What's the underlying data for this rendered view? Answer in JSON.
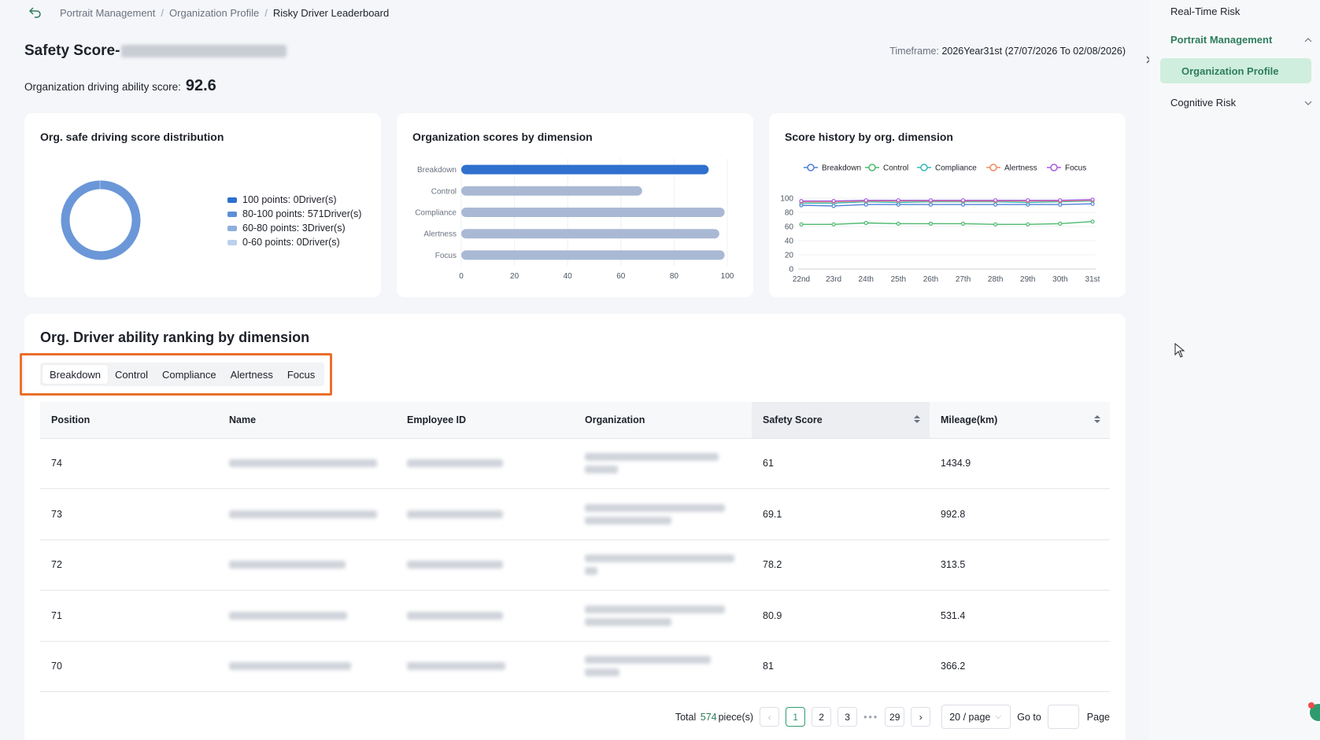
{
  "breadcrumb": {
    "items": [
      "Portrait Management",
      "Organization Profile",
      "Risky Driver Leaderboard"
    ]
  },
  "header": {
    "title_prefix": "Safety Score-",
    "timeframe_label": "Timeframe:",
    "timeframe_value": "2026Year31st (27/07/2026 To 02/08/2026)",
    "org_score_label": "Organization driving ability score:",
    "org_score_value": "92.6"
  },
  "cards": {
    "distribution": {
      "title": "Org. safe driving score distribution",
      "legend": [
        {
          "label": "100 points: 0Driver(s)",
          "color": "#2f6fce"
        },
        {
          "label": "80-100 points: 571Driver(s)",
          "color": "#5b8fd6"
        },
        {
          "label": "60-80 points: 3Driver(s)",
          "color": "#8faedd"
        },
        {
          "label": "0-60 points: 0Driver(s)",
          "color": "#bcd0ee"
        }
      ]
    },
    "dimension": {
      "title": "Organization scores by dimension"
    },
    "history": {
      "title": "Score history by org. dimension"
    }
  },
  "chart_data": [
    {
      "type": "pie",
      "title": "Org. safe driving score distribution",
      "categories": [
        "100 points",
        "80-100 points",
        "60-80 points",
        "0-60 points"
      ],
      "values": [
        0,
        571,
        3,
        0
      ],
      "colors": [
        "#2f6fce",
        "#6b97d8",
        "#8faedd",
        "#bcd0ee"
      ]
    },
    {
      "type": "bar",
      "title": "Organization scores by dimension",
      "orientation": "horizontal",
      "categories": [
        "Breakdown",
        "Control",
        "Compliance",
        "Alertness",
        "Focus"
      ],
      "values": [
        93,
        68,
        99,
        97,
        99
      ],
      "xlim": [
        0,
        100
      ],
      "ticks": [
        0,
        20,
        40,
        60,
        80,
        100
      ],
      "highlight_color": "#2f6fce",
      "color": "#a9b9d4"
    },
    {
      "type": "line",
      "title": "Score history by org. dimension",
      "x": [
        "22nd",
        "23rd",
        "24th",
        "25th",
        "26th",
        "27th",
        "28th",
        "29th",
        "30th",
        "31st"
      ],
      "ylim": [
        0,
        100
      ],
      "yticks": [
        0,
        20,
        40,
        60,
        80,
        100
      ],
      "legend_position": "top",
      "series": [
        {
          "name": "Breakdown",
          "color": "#4f7fd9",
          "values": [
            90,
            89,
            91,
            91,
            91,
            91,
            91,
            91,
            91,
            92
          ]
        },
        {
          "name": "Control",
          "color": "#4cba6c",
          "values": [
            63,
            63,
            65,
            64,
            64,
            64,
            63,
            63,
            64,
            67
          ]
        },
        {
          "name": "Compliance",
          "color": "#36b8b8",
          "values": [
            93,
            93,
            95,
            94,
            95,
            95,
            95,
            94,
            95,
            96
          ]
        },
        {
          "name": "Alertness",
          "color": "#f08a5d",
          "values": [
            95,
            95,
            96,
            96,
            96,
            96,
            96,
            96,
            96,
            97
          ]
        },
        {
          "name": "Focus",
          "color": "#a85ce0",
          "values": [
            96,
            96,
            97,
            97,
            97,
            97,
            97,
            97,
            97,
            98
          ]
        }
      ]
    }
  ],
  "ranking": {
    "title": "Org. Driver ability ranking by dimension",
    "tabs": [
      "Breakdown",
      "Control",
      "Compliance",
      "Alertness",
      "Focus"
    ],
    "columns": [
      "Position",
      "Name",
      "Employee ID",
      "Organization",
      "Safety Score",
      "Mileage(km)"
    ],
    "rows": [
      {
        "position": "74",
        "score": "61",
        "mileage": "1434.9"
      },
      {
        "position": "73",
        "score": "69.1",
        "mileage": "992.8"
      },
      {
        "position": "72",
        "score": "78.2",
        "mileage": "313.5"
      },
      {
        "position": "71",
        "score": "80.9",
        "mileage": "531.4"
      },
      {
        "position": "70",
        "score": "81",
        "mileage": "366.2"
      }
    ]
  },
  "pagination": {
    "total_prefix": "Total",
    "total": "574",
    "total_suffix": "piece(s)",
    "pages": [
      "1",
      "2",
      "3",
      "29"
    ],
    "prev": "‹",
    "next": "›",
    "dots": "•••",
    "page_size": "20 / page",
    "goto_label": "Go to",
    "page_label": "Page"
  },
  "sidebar": {
    "items": [
      {
        "label": "Real-Time Risk"
      },
      {
        "label": "Portrait Management"
      },
      {
        "label": "Organization Profile"
      },
      {
        "label": "Cognitive Risk"
      }
    ]
  }
}
